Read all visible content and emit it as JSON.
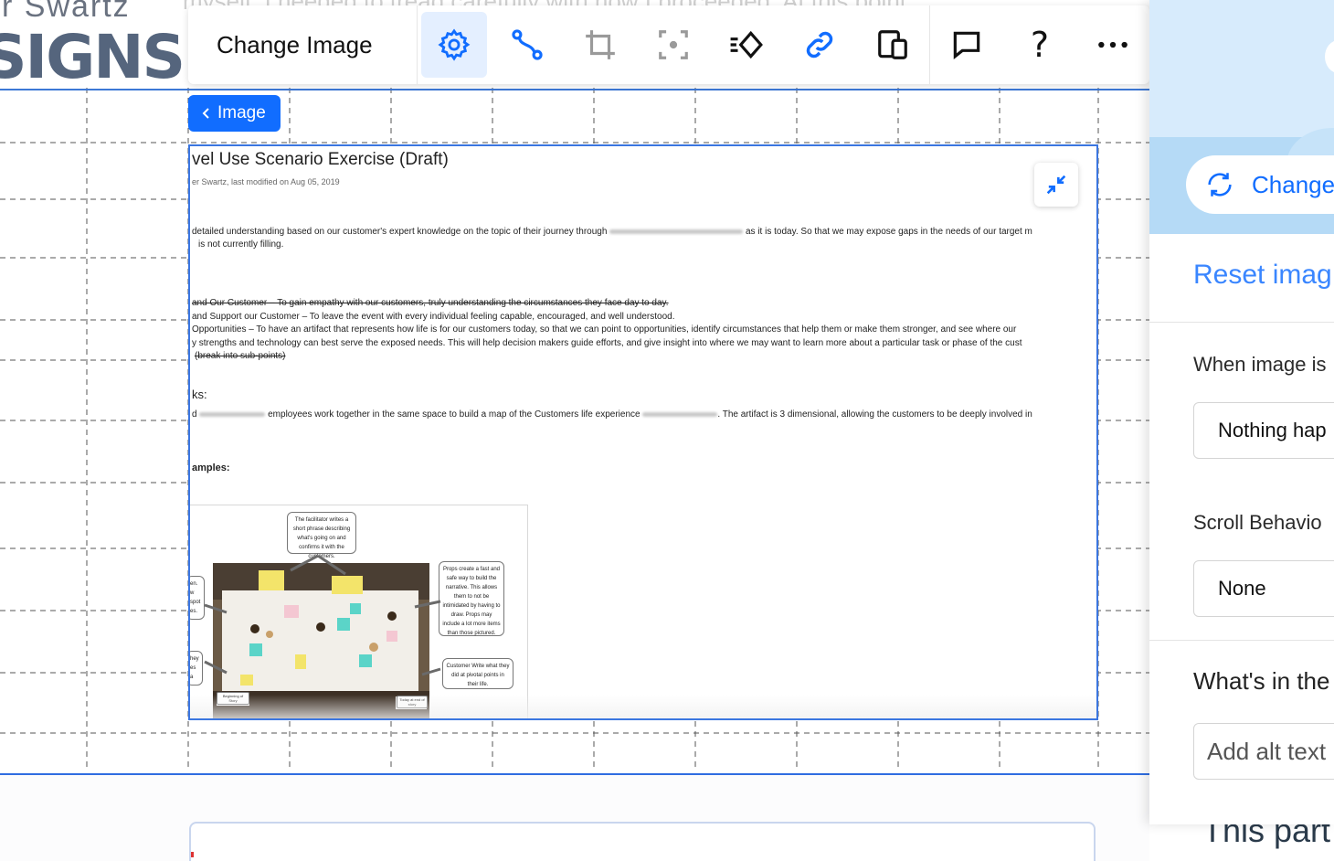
{
  "background": {
    "top_text": "myself. I needed to tread carefully with how I proceeded. At this point",
    "logo_top": "r Swartz",
    "logo_main": "SIGNS",
    "bottom_right_text": "This part"
  },
  "toolbar": {
    "title": "Change Image",
    "buttons": [
      {
        "id": "settings",
        "icon": "gear-icon",
        "active": true
      },
      {
        "id": "animation",
        "icon": "curve-path-icon"
      },
      {
        "id": "crop",
        "icon": "crop-icon"
      },
      {
        "id": "focal-point",
        "icon": "focal-point-icon"
      },
      {
        "id": "animate",
        "icon": "diamond-motion-icon"
      },
      {
        "id": "link",
        "icon": "link-icon"
      },
      {
        "id": "layout",
        "icon": "devices-icon"
      },
      {
        "id": "comment",
        "icon": "comment-icon"
      },
      {
        "id": "help",
        "icon": "help-icon",
        "label": "?"
      },
      {
        "id": "more",
        "icon": "more-icon"
      }
    ]
  },
  "breadcrumb": {
    "label": "Image"
  },
  "document": {
    "title": "vel Use Scenario Exercise (Draft)",
    "meta": "er Swartz, last modified on Aug 05, 2019",
    "lines": [
      "detailed understanding based on our customer's expert knowledge on the topic of their journey through",
      "as it is today. So that we may expose gaps in the needs of our target m",
      "is not currently filling.",
      "and Our Customer – To gain empathy with our customers, truly understanding the circumstances they face day to day.",
      "and Support our Customer – To leave the event with every individual feeling capable, encouraged, and well understood.",
      "Opportunities – To have an artifact that represents how life is for our customers today, so that we can point to opportunities, identify circumstances that help them or make them stronger, and see where our",
      "y strengths and technology can best serve the exposed needs. This will help decision makers guide efforts, and give insight into where we may want to learn more about a particular task or phase of the cust",
      "(break into sub-points)"
    ],
    "tasks_heading": "ks:",
    "tasks_line_a": "d",
    "tasks_line_b": "employees work together in the same space to build a map of the Customers life experience",
    "tasks_line_c": ". The artifact is 3 dimensional, allowing the customers to be deeply involved in",
    "examples_heading": "amples:",
    "callouts": {
      "top": "The facilitator writes a short phrase describing what's going on and confirms it with the customers.",
      "right": "Props create a fast and safe way to build the narrative. This allows them to not be intimidated by having to draw. Props may include a lot more items than those pictured.",
      "right_low": "Customer Write what they did at pivotal points in their life.",
      "left_a": "en. w spot es.",
      "left_b": "hey es a",
      "photo_bl": "Beginning of Story",
      "photo_br": "Today at end of story"
    }
  },
  "panel": {
    "change_button": "Change",
    "reset_link": "Reset imag",
    "click_label": "When image is",
    "click_value": "Nothing hap",
    "scroll_label": "Scroll Behavio",
    "scroll_value": "None",
    "alt_heading": "What's in the",
    "alt_placeholder": "Add alt text"
  },
  "colors": {
    "accent": "#116dff",
    "guide": "#3b76e0",
    "panel_hero": "#d7ebfc"
  }
}
